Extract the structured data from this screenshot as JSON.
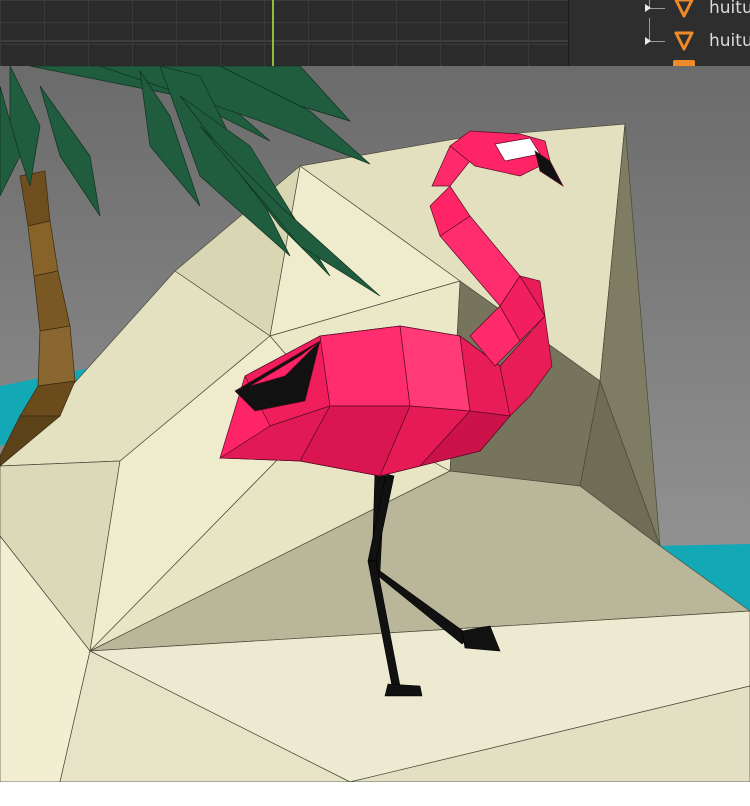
{
  "outliner": {
    "items": [
      {
        "label": "huitu",
        "icon": "cone-icon"
      },
      {
        "label": "huitu",
        "icon": "cone-icon"
      }
    ]
  },
  "colors": {
    "flamingo": "#ff2466",
    "beak": "#111111",
    "rock_light": "#efeccc",
    "rock_mid": "#d8d5b3",
    "rock_shadow": "#8e8c70",
    "palm_leaf": "#1f5d3e",
    "palm_trunk": "#7a5a2a",
    "water": "#13a8b5",
    "sky_top": "#6d6d6d",
    "sky_bottom": "#a2a2a2",
    "outliner_icon": "#ee8a2a"
  }
}
